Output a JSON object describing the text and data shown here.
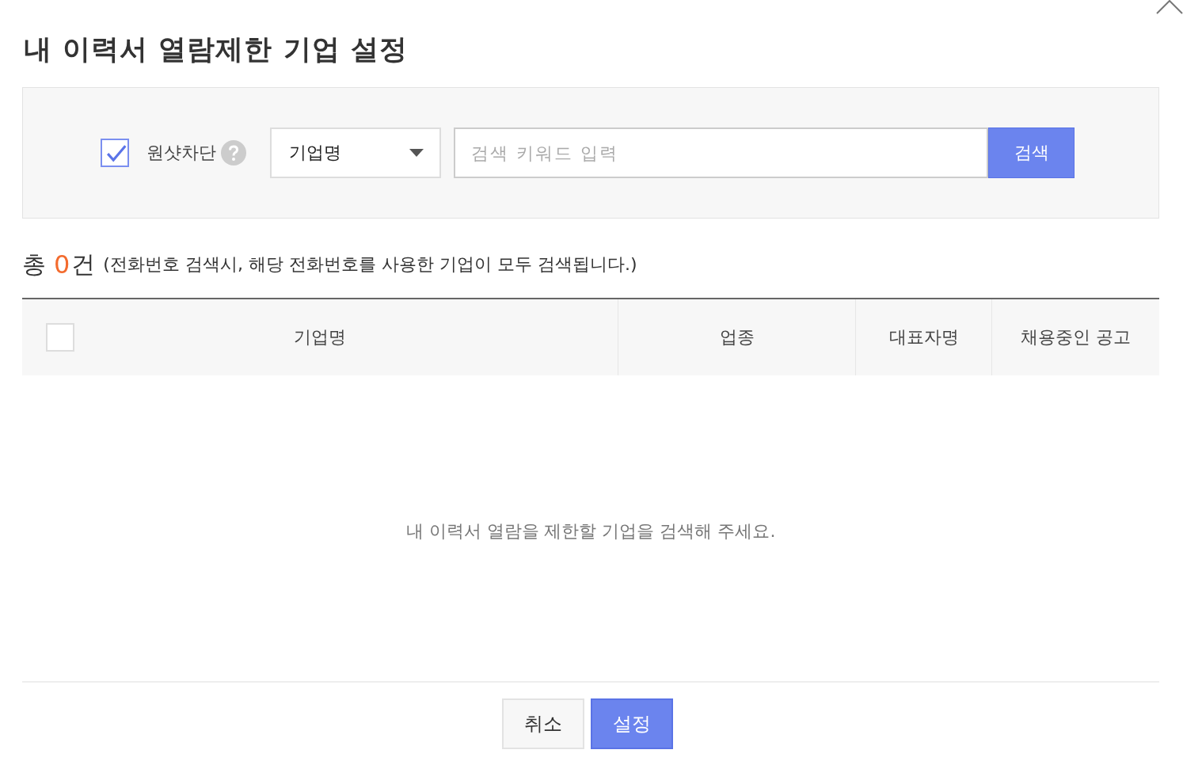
{
  "title": "내 이력서 열람제한 기업 설정",
  "search": {
    "oneshot": {
      "label": "원샷차단",
      "checked": true
    },
    "select": {
      "value": "기업명"
    },
    "keyword": {
      "placeholder": "검색 키워드 입력"
    },
    "button": "검색"
  },
  "total": {
    "prefix": "총",
    "count": "0",
    "suffix": "건",
    "note": "(전화번호 검색시, 해당 전화번호를 사용한 기업이 모두 검색됩니다.)"
  },
  "table": {
    "select_all": {
      "checked": false
    },
    "columns": [
      "기업명",
      "업종",
      "대표자명",
      "채용중인 공고"
    ],
    "empty_message": "내 이력서 열람을 제한할 기업을 검색해 주세요."
  },
  "buttons": [
    {
      "label": "취소",
      "kind": "secondary"
    },
    {
      "label": "설정",
      "kind": "primary"
    }
  ]
}
